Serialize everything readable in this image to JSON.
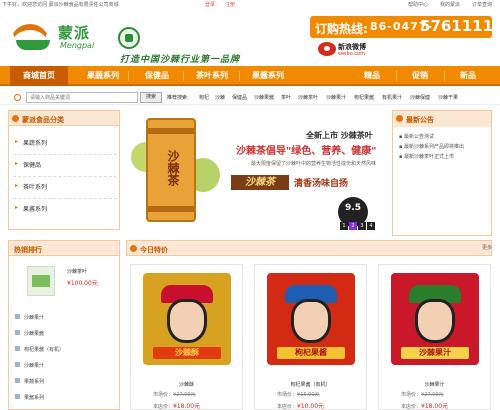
{
  "topbar": {
    "welcome": "下午好，欢迎您访问 蒙派沙棘食品有限责任公司商城",
    "login": "登录",
    "register": "注册",
    "help": "帮助中心",
    "mine": "我的蒙派",
    "order": "订单查询"
  },
  "brand": {
    "name_cn": "蒙派",
    "name_en": "Mengpai",
    "slogan": "打造中国沙棘行业第一品牌"
  },
  "hotline": {
    "label": "订购热线:",
    "area": "86-0477-",
    "number": "5761111"
  },
  "weibo": {
    "cn": "新浪微博",
    "en": "weibo.com"
  },
  "nav": {
    "items": [
      "商城首页",
      "果蔬系列",
      "保健品",
      "茶叶系列",
      "果酱系列",
      "精品",
      "促销",
      "新品"
    ]
  },
  "search": {
    "placeholder": "请输入商品关键词",
    "button": "搜索",
    "hot_label": "推荐搜索:",
    "keywords": [
      "枸杞",
      "沙棘",
      "保健品",
      "沙棘果酱",
      "茶叶",
      "沙棘茶叶",
      "沙棘果汁",
      "枸杞果酱",
      "有机果汁",
      "沙棘保健",
      "沙棘干果"
    ]
  },
  "categories": {
    "title": "蒙派食品分类",
    "items": [
      "果蔬系列",
      "保健品",
      "茶叶系列",
      "果酱系列"
    ]
  },
  "banner": {
    "can_text": "沙棘茶",
    "new_label": "全新上市 沙棘茶叶",
    "headline": "沙棘茶倡导\"绿色、营养、健康\"",
    "sub": "最大限度保留了沙棘叶中的营养生物活性成份和天然风味",
    "tag": "沙棘茶",
    "tagline": "清香汤味自扬",
    "date": "9.5",
    "pages": [
      "1",
      "2",
      "3",
      "4"
    ]
  },
  "announcements": {
    "title": "最新公告",
    "items": [
      "最新公告测试",
      "最新沙棘系列产品即将推出",
      "最新沙棘茶叶正式上市"
    ]
  },
  "hot_ranking": {
    "title": "热销排行",
    "top_name": "沙棘茶叶",
    "top_price": "¥100.00元",
    "items": [
      "沙棘果汁",
      "沙棘果酱",
      "枸杞果酱（有机）",
      "沙棘果汁",
      "果蔬系列",
      "果酱系列"
    ]
  },
  "special": {
    "title": "今日特价",
    "more": "更多",
    "products": [
      {
        "name": "沙棘酥",
        "market_label": "市场价：",
        "market": "¥27.00元",
        "price_label": "本店价：",
        "price": "¥18.00元",
        "label": "沙棘酥",
        "color": "#d7a21f"
      },
      {
        "name": "枸杞果酱（有机）",
        "market_label": "市场价：",
        "market": "¥15.00元",
        "price_label": "本店价：",
        "price": "¥10.00元",
        "label": "枸杞果酱",
        "color": "#d32a14"
      },
      {
        "name": "沙棘果汁",
        "market_label": "市场价：",
        "market": "¥27.00元",
        "price_label": "本店价：",
        "price": "¥18.00元",
        "label": "沙棘果汁",
        "color": "#c8182a"
      }
    ]
  },
  "colors": {
    "brand_orange": "#f08a00",
    "brand_green": "#2e9a3a",
    "price_red": "#d22222"
  }
}
